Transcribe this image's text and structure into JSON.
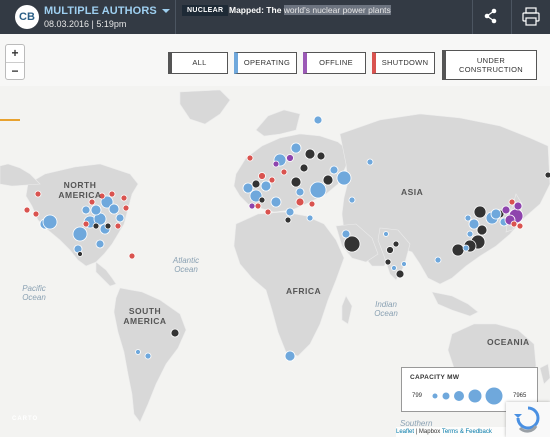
{
  "header": {
    "logo_text": "CB",
    "author": "MULTIPLE AUTHORS",
    "date": "08.03.2016 | 5:19pm",
    "tag": "NUCLEAR",
    "headline_prefix": "Mapped: The",
    "headline_highlight": "world's nuclear power plants",
    "share_icon": "share-icon",
    "print_icon": "print-icon"
  },
  "filters": [
    {
      "label": "ALL",
      "color": "#555555"
    },
    {
      "label": "OPERATING",
      "color": "#6fa8dc"
    },
    {
      "label": "OFFLINE",
      "color": "#9b59b6"
    },
    {
      "label": "SHUTDOWN",
      "color": "#d9534f"
    },
    {
      "label": "UNDER CONSTRUCTION",
      "color": "#555555"
    }
  ],
  "zoom": {
    "in": "+",
    "out": "−"
  },
  "map_labels": {
    "north_america": "NORTH AMERICA",
    "south_america": "SOUTH AMERICA",
    "africa": "AFRICA",
    "asia": "ASIA",
    "oceania": "OCEANIA",
    "atlantic": "Atlantic Ocean",
    "pacific": "Pacific Ocean",
    "indian": "Indian Ocean",
    "southern": "Southern"
  },
  "legend": {
    "title": "CAPACITY MW",
    "min": "799",
    "max": "7965"
  },
  "colors": {
    "operating": "#6fa8dc",
    "offline": "#8e44ad",
    "shutdown": "#d9534f",
    "construction": "#333333",
    "land": "#d8d8d8",
    "water": "#f3f3f1"
  },
  "attribution": {
    "leaflet": "Leaflet",
    "sep": " | Mapbox ",
    "terms": "Terms & Feedback"
  },
  "carto": "CARTO"
}
